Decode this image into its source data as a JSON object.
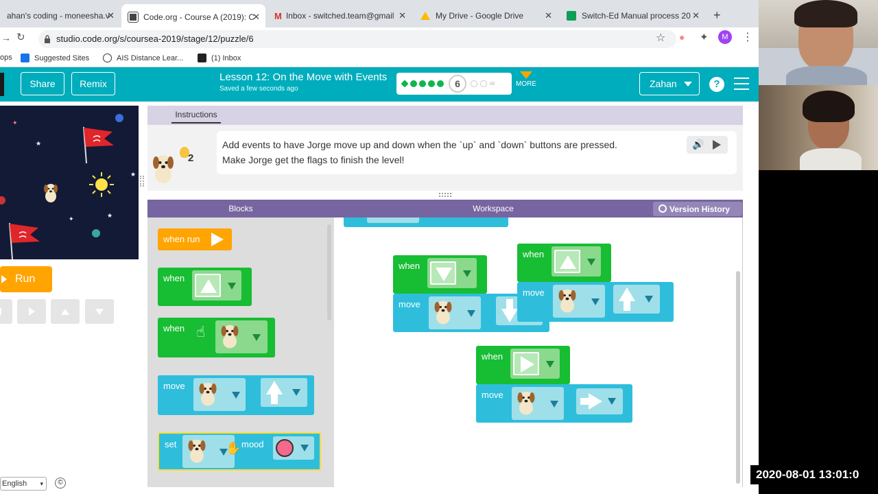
{
  "browser": {
    "tabs": [
      {
        "title": "ahan's coding - moneesha.v",
        "active": false
      },
      {
        "title": "Code.org - Course A (2019): C",
        "active": true
      },
      {
        "title": "Inbox - switched.team@gmail",
        "active": false
      },
      {
        "title": "My Drive - Google Drive",
        "active": false
      },
      {
        "title": "Switch-Ed Manual process 20",
        "active": false
      }
    ],
    "new_tab": "+",
    "url": "studio.code.org/s/coursea-2019/stage/12/puzzle/6",
    "bookmarks": [
      "ops",
      "Suggested Sites",
      "AIS Distance Lear...",
      "(1) Inbox"
    ],
    "profile_initial": "M"
  },
  "header": {
    "share_label": "Share",
    "remix_label": "Remix",
    "lesson_title": "Lesson 12: On the Move with Events",
    "saved_status": "Saved a few seconds ago",
    "current_puzzle": "6",
    "more_label": "MORE",
    "user_name": "Zahan",
    "help_label": "?"
  },
  "stage": {
    "run_label": "Run"
  },
  "instructions": {
    "tab_label": "Instructions",
    "hint_count": "2",
    "line1": "Add events to have Jorge move up and down when the `up` and `down` buttons are pressed.",
    "line2": "Make Jorge get the flags to finish the level!"
  },
  "editor": {
    "blocks_label": "Blocks",
    "workspace_label": "Workspace",
    "version_history_label": "Version History"
  },
  "toolbox": {
    "when_run": "when run",
    "when": "when",
    "move": "move",
    "set": "set",
    "mood": "mood"
  },
  "workspace": {
    "when": "when",
    "move": "move"
  },
  "footer": {
    "language": "English",
    "copyright": "©"
  },
  "recording": {
    "timestamp": "2020-08-01  13:01:0"
  },
  "colors": {
    "header": "#00adbc",
    "event_block": "#17bd33",
    "action_block": "#2ebedc",
    "run_block": "#ffa400",
    "editor_header": "#7665a0"
  }
}
